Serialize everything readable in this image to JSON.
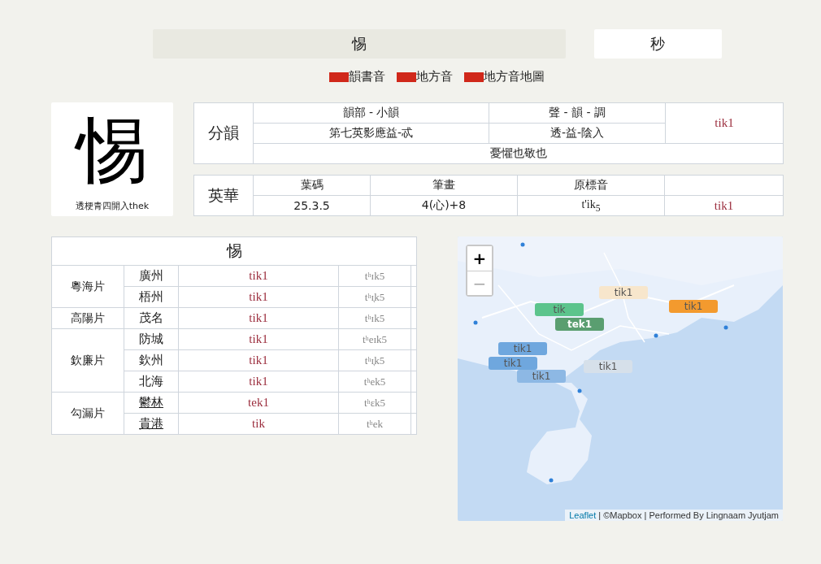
{
  "search": {
    "value": "惕",
    "button": "秒"
  },
  "legend": [
    {
      "label": "韻書音",
      "color": "#d0281a"
    },
    {
      "label": "地方音",
      "color": "#d0281a"
    },
    {
      "label": "地方音地圖",
      "color": "#d0281a"
    }
  ],
  "character": {
    "glyph": "惕",
    "caption": "透梗青四開入thek"
  },
  "fenyun": {
    "title": "分韻",
    "head_1": "韻部 - 小韻",
    "head_2": "聲 - 韻 - 調",
    "value_1": "第七英影應益-忒",
    "value_2": "透-益-陰入",
    "reading": "tik1",
    "gloss": "憂懼也敬也"
  },
  "yinghua": {
    "title": "英華",
    "columns": [
      "葉碼",
      "筆畫",
      "原標音"
    ],
    "values": [
      "25.3.5",
      "4(心)+8",
      "t'ik$_{5}$",
      "tik1"
    ]
  },
  "dialects": {
    "title": "惕",
    "groups": [
      {
        "name": "粵海片",
        "places": [
          {
            "name": "廣州",
            "link": false,
            "reading": "tik1",
            "ipa": "tʰɪk5"
          },
          {
            "name": "梧州",
            "link": false,
            "reading": "tik1",
            "ipa": "tʰɪ̞k5"
          }
        ]
      },
      {
        "name": "高陽片",
        "places": [
          {
            "name": "茂名",
            "link": false,
            "reading": "tik1",
            "ipa": "tʰɪk5"
          }
        ]
      },
      {
        "name": "欽廉片",
        "places": [
          {
            "name": "防城",
            "link": false,
            "reading": "tik1",
            "ipa": "tʰeɪk5"
          },
          {
            "name": "欽州",
            "link": false,
            "reading": "tik1",
            "ipa": "tʰɪ̞k5"
          },
          {
            "name": "北海",
            "link": false,
            "reading": "tik1",
            "ipa": "tʰek5"
          }
        ]
      },
      {
        "name": "勾漏片",
        "places": [
          {
            "name": "鬱林",
            "link": true,
            "reading": "tek1",
            "ipa": "tʰɛk5"
          },
          {
            "name": "貴港",
            "link": true,
            "reading": "tik",
            "ipa": "tʰek"
          }
        ]
      }
    ]
  },
  "map": {
    "zoom_in": "+",
    "zoom_out": "−",
    "markers": [
      {
        "label": "tik1",
        "color": "#f7e6cc"
      },
      {
        "label": "tik",
        "color": "#5cc48c"
      },
      {
        "label": "tek1",
        "color": "#5a9e70"
      },
      {
        "label": "tik1",
        "color": "#f39a2e"
      },
      {
        "label": "tik1",
        "color": "#6fa7de"
      },
      {
        "label": "tik1",
        "color": "#6fa7de"
      },
      {
        "label": "tik1",
        "color": "#8db8e4"
      },
      {
        "label": "tik1",
        "color": "#d6e0ea"
      }
    ],
    "attribution_link": "Leaflet",
    "attribution": "| ©Mapbox | Performed By Lingnaam Jyutjam"
  }
}
